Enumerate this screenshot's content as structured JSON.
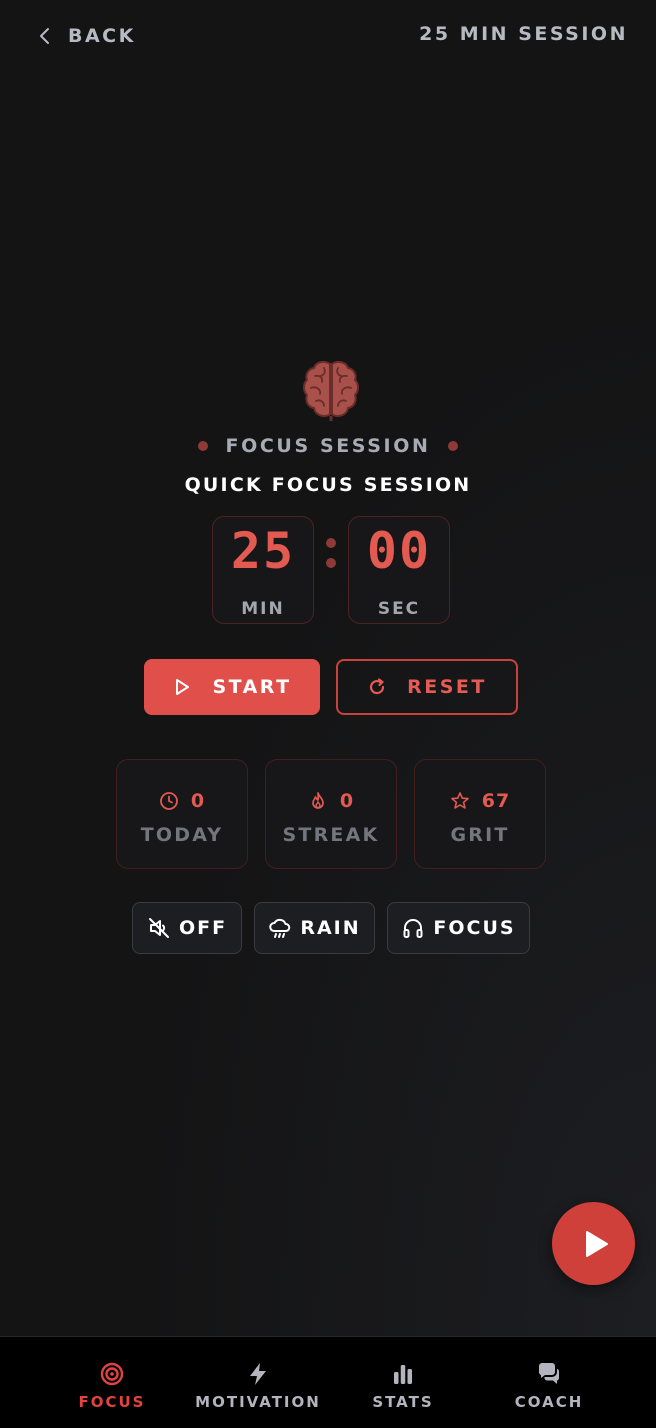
{
  "header": {
    "back_label": "BACK",
    "session_label": "25 MIN SESSION"
  },
  "session": {
    "tag": "FOCUS SESSION",
    "title": "QUICK FOCUS SESSION",
    "icon": "brain-icon"
  },
  "timer": {
    "minutes": "25",
    "seconds": "00",
    "min_label": "MIN",
    "sec_label": "SEC"
  },
  "controls": {
    "start_label": "START",
    "reset_label": "RESET"
  },
  "stats": {
    "today": {
      "value": "0",
      "label": "TODAY",
      "icon": "clock-icon"
    },
    "streak": {
      "value": "0",
      "label": "STREAK",
      "icon": "flame-icon"
    },
    "grit": {
      "value": "67",
      "label": "GRIT",
      "icon": "star-icon"
    }
  },
  "sounds": [
    {
      "label": "OFF",
      "icon": "muted-speaker-icon"
    },
    {
      "label": "RAIN",
      "icon": "rain-cloud-icon"
    },
    {
      "label": "FOCUS",
      "icon": "headphones-icon"
    }
  ],
  "nav": [
    {
      "label": "FOCUS",
      "icon": "target-icon",
      "active": true
    },
    {
      "label": "MOTIVATION",
      "icon": "lightning-icon",
      "active": false
    },
    {
      "label": "STATS",
      "icon": "bar-chart-icon",
      "active": false
    },
    {
      "label": "COACH",
      "icon": "chat-bubbles-icon",
      "active": false
    }
  ],
  "colors": {
    "background": "#141415",
    "accent": "#e14f4b",
    "accent_dark": "#8e3a36",
    "muted_text": "#74757e"
  }
}
